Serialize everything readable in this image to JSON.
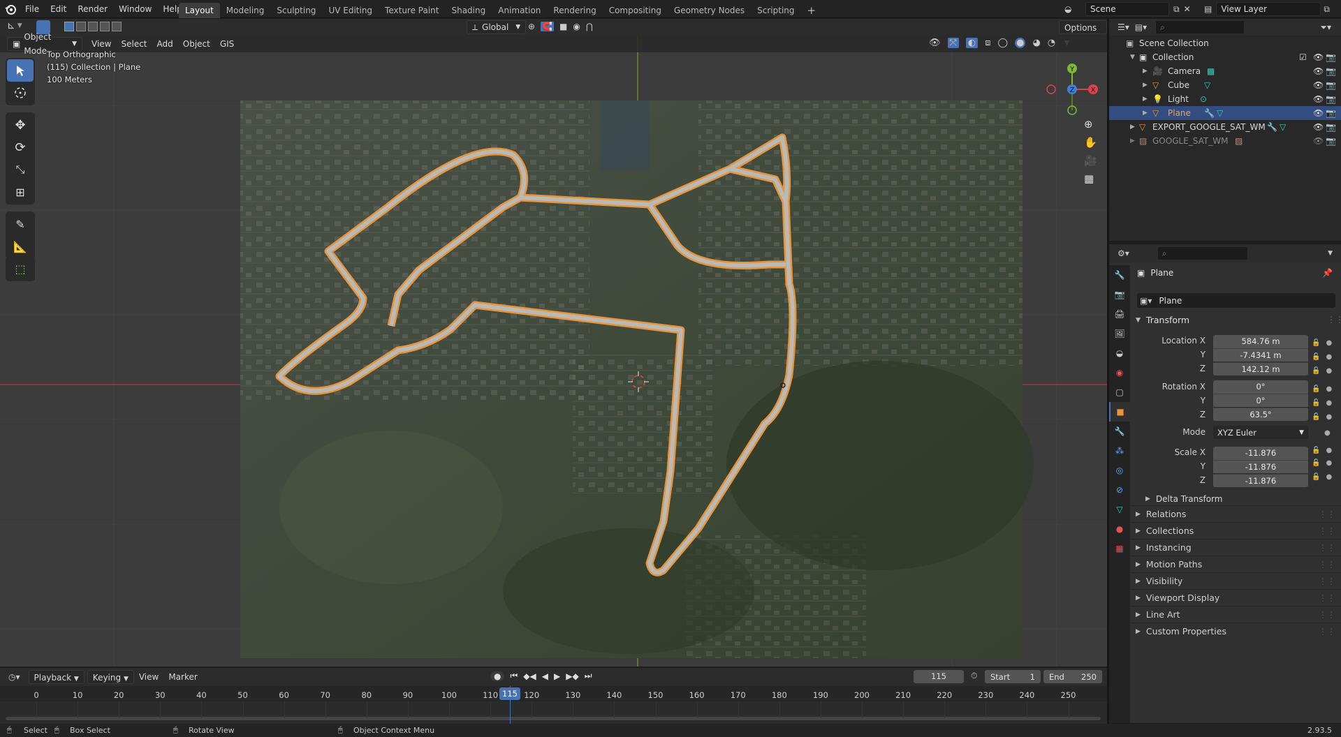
{
  "topbar": {
    "menus": [
      "File",
      "Edit",
      "Render",
      "Window",
      "Help"
    ],
    "workspaces": [
      "Layout",
      "Modeling",
      "Sculpting",
      "UV Editing",
      "Texture Paint",
      "Shading",
      "Animation",
      "Rendering",
      "Compositing",
      "Geometry Nodes",
      "Scripting"
    ],
    "active_workspace": "Layout",
    "scene": "Scene",
    "view_layer": "View Layer"
  },
  "viewport": {
    "mode": "Object Mode",
    "menus": [
      "View",
      "Select",
      "Add",
      "Object",
      "GIS"
    ],
    "transform_orientation": "Global",
    "options_label": "Options",
    "overlay_lines": [
      "Top Orthographic",
      "(115) Collection | Plane",
      "100 Meters"
    ],
    "gizmo_axes": {
      "x": "X",
      "y": "Y",
      "z": "Z"
    }
  },
  "outliner": {
    "rows": [
      {
        "label": "Scene Collection",
        "icon": "scene-collection-icon"
      },
      {
        "label": "Collection",
        "icon": "collection-icon"
      },
      {
        "label": "Camera",
        "icon": "camera-object-icon"
      },
      {
        "label": "Cube",
        "icon": "mesh-object-icon"
      },
      {
        "label": "Light",
        "icon": "light-object-icon"
      },
      {
        "label": "Plane",
        "icon": "mesh-object-icon"
      },
      {
        "label": "EXPORT_GOOGLE_SAT_WM",
        "icon": "mesh-object-icon"
      },
      {
        "label": "GOOGLE_SAT_WM",
        "icon": "image-icon"
      }
    ]
  },
  "properties": {
    "object_name": "Plane",
    "datablock_name": "Plane",
    "transform_label": "Transform",
    "location_label": "Location X",
    "location": [
      "584.76 m",
      "-7.4341 m",
      "142.12 m"
    ],
    "rotation_label": "Rotation X",
    "rotation": [
      "0°",
      "0°",
      "63.5°"
    ],
    "mode_label": "Mode",
    "mode_value": "XYZ Euler",
    "scale_label": "Scale X",
    "scale": [
      "-11.876",
      "-11.876",
      "-11.876"
    ],
    "axis_y": "Y",
    "axis_z": "Z",
    "delta_transform": "Delta Transform",
    "panels": [
      "Relations",
      "Collections",
      "Instancing",
      "Motion Paths",
      "Visibility",
      "Viewport Display",
      "Line Art",
      "Custom Properties"
    ]
  },
  "timeline": {
    "menus": [
      "Playback",
      "Keying",
      "View",
      "Marker"
    ],
    "current_frame": "115",
    "start_label": "Start",
    "start": "1",
    "end_label": "End",
    "end": "250",
    "ticks": [
      "0",
      "10",
      "20",
      "30",
      "40",
      "50",
      "60",
      "70",
      "80",
      "90",
      "100",
      "110",
      "120",
      "130",
      "140",
      "150",
      "160",
      "170",
      "180",
      "190",
      "200",
      "210",
      "220",
      "230",
      "240",
      "250"
    ]
  },
  "statusbar": {
    "select": "Select",
    "box_select": "Box Select",
    "rotate_view": "Rotate View",
    "context_menu": "Object Context Menu",
    "version": "2.93.5"
  },
  "colors": {
    "accent": "#4772b3",
    "selected_outline": "#e8943a",
    "axis_x": "#e0414f",
    "axis_y": "#7fb832",
    "axis_z": "#3e82d6"
  }
}
